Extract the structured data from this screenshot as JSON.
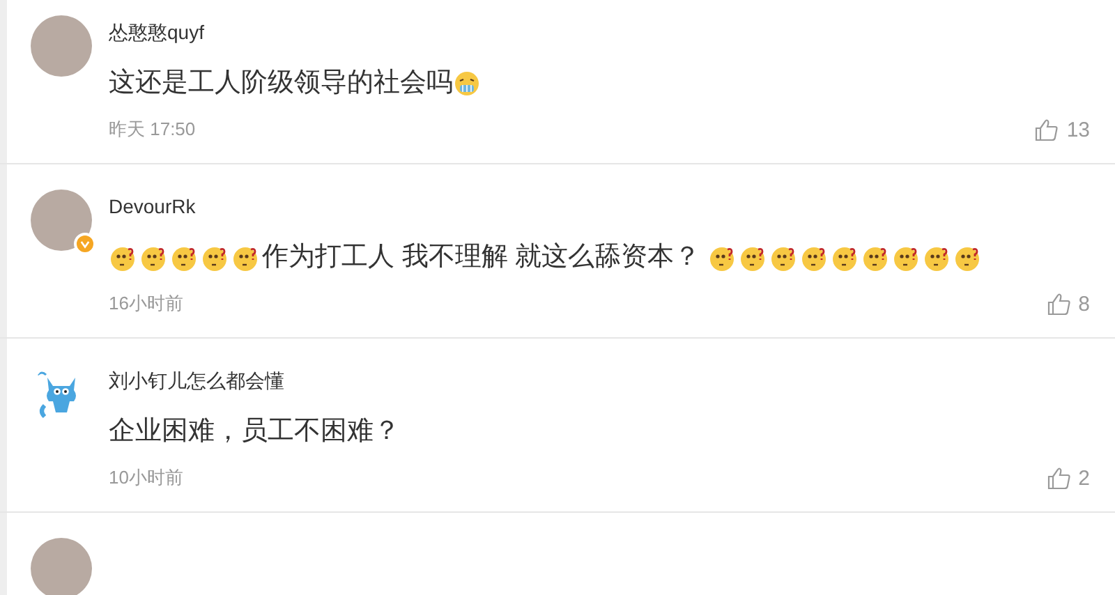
{
  "comments": [
    {
      "kind": "photo",
      "verified": false,
      "name": "怂憨憨quyf",
      "body": [
        {
          "kind": "text",
          "text": "这还是工人阶级领导的社会吗"
        },
        {
          "kind": "freezing"
        }
      ],
      "time": "昨天 17:50",
      "likes": "13"
    },
    {
      "kind": "photo",
      "verified": true,
      "name": "DevourRk",
      "body": [
        {
          "kind": "puzzled"
        },
        {
          "kind": "puzzled"
        },
        {
          "kind": "puzzled"
        },
        {
          "kind": "puzzled"
        },
        {
          "kind": "puzzled"
        },
        {
          "kind": "text",
          "text": "作为打工人 我不理解 就这么舔资本？ "
        },
        {
          "kind": "puzzled"
        },
        {
          "kind": "puzzled"
        },
        {
          "kind": "puzzled"
        },
        {
          "kind": "puzzled"
        },
        {
          "kind": "puzzled"
        },
        {
          "kind": "puzzled"
        },
        {
          "kind": "puzzled"
        },
        {
          "kind": "puzzled"
        },
        {
          "kind": "puzzled"
        }
      ],
      "time": "16小时前",
      "likes": "8"
    },
    {
      "kind": "cartoon",
      "verified": false,
      "name": "刘小钉儿怎么都会懂",
      "body": [
        {
          "kind": "text",
          "text": "企业困难，员工不困难？"
        }
      ],
      "time": "10小时前",
      "likes": "2"
    },
    {
      "kind": "photo",
      "verified": false
    }
  ]
}
